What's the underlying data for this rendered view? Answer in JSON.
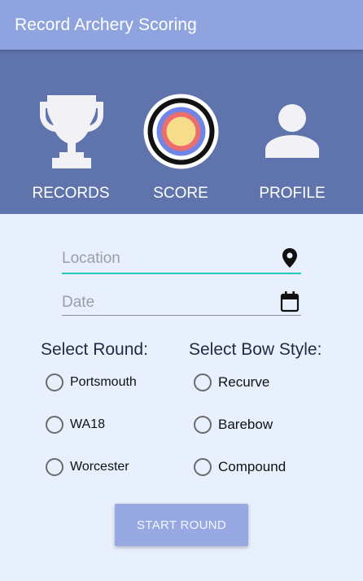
{
  "appbar": {
    "title": "Record Archery Scoring"
  },
  "nav": {
    "items": [
      {
        "label": "RECORDS",
        "icon": "trophy-icon"
      },
      {
        "label": "SCORE",
        "icon": "target-icon"
      },
      {
        "label": "PROFILE",
        "icon": "person-icon"
      }
    ]
  },
  "form": {
    "location": {
      "placeholder": "Location",
      "value": "",
      "icon": "map-pin-icon"
    },
    "date": {
      "placeholder": "Date",
      "value": "",
      "icon": "calendar-icon"
    }
  },
  "round": {
    "heading": "Select Round:",
    "options": [
      "Portsmouth",
      "WA18",
      "Worcester"
    ],
    "selected": null
  },
  "bow": {
    "heading": "Select Bow Style:",
    "options": [
      "Recurve",
      "Barebow",
      "Compound"
    ],
    "selected": null
  },
  "actions": {
    "start_label": "START ROUND"
  },
  "colors": {
    "appbar": "#8fa3df",
    "hero": "#5f73ad",
    "background": "#e8f0fd",
    "accent_underline": "#22c9b7",
    "button": "#97a8e3",
    "target_yellow": "#f7dc8a",
    "target_red": "#ec6d6d",
    "target_blue": "#6f86e8"
  }
}
